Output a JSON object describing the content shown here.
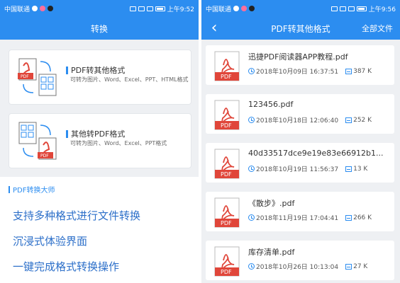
{
  "left": {
    "status": {
      "carrier": "中国联通",
      "time": "上午9:52"
    },
    "title": "转换",
    "cards": [
      {
        "title": "PDF转其他格式",
        "desc": "可转为图片、Word、Excel、PPT、HTML格式"
      },
      {
        "title": "其他转PDF格式",
        "desc": "可转为图片、Word、Excel、PPT格式"
      }
    ],
    "promo": {
      "heading": "PDF转换大师",
      "lines": [
        "支持多种格式进行文件转换",
        "沉浸式体验界面",
        "一键完成格式转换操作"
      ]
    }
  },
  "right": {
    "status": {
      "carrier": "中国联通",
      "time": "上午9:56"
    },
    "title": "PDF转其他格式",
    "action": "全部文件",
    "files": [
      {
        "name": "迅捷PDF阅读器APP教程.pdf",
        "date": "2018年10月09日 16:37:51",
        "size": "387 K"
      },
      {
        "name": "123456.pdf",
        "date": "2018年10月18日 12:06:40",
        "size": "252 K"
      },
      {
        "name": "40d33517dce9e19e83e66912b1...",
        "date": "2018年10月19日 11:56:37",
        "size": "13 K"
      },
      {
        "name": "《散步》.pdf",
        "date": "2018年11月19日 17:04:41",
        "size": "266 K"
      },
      {
        "name": "库存清单.pdf",
        "date": "2018年10月26日 10:13:04",
        "size": "27 K"
      }
    ],
    "file_badge": "PDF"
  },
  "colors": {
    "accent": "#2c8df0",
    "pdf_red": "#e0463a"
  }
}
